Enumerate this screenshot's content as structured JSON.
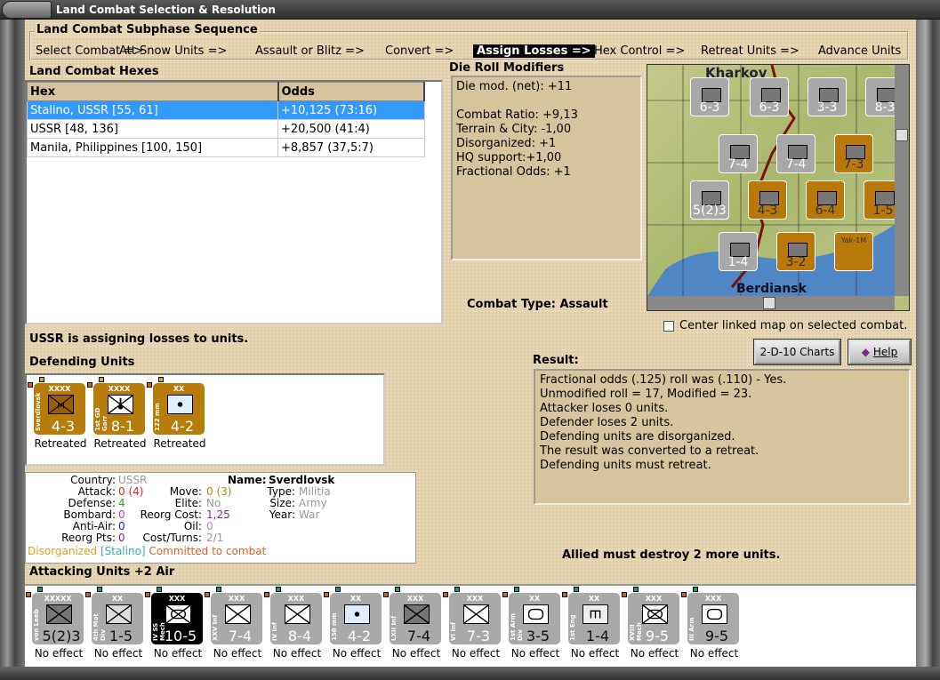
{
  "window": {
    "title": "Land Combat Selection & Resolution"
  },
  "sequence": {
    "title": "Land Combat Subphase Sequence",
    "items": [
      "Select Combat =>",
      "Att Snow Units =>",
      "Assault or Blitz =>",
      "Convert =>",
      "Assign Losses =>",
      "Hex Control =>",
      "Retreat Units =>",
      "Advance Units"
    ],
    "active_index": 4
  },
  "hexes": {
    "title": "Land Combat Hexes",
    "columns": [
      "Hex",
      "Odds"
    ],
    "rows": [
      [
        "Stalino, USSR [55, 61]",
        "+10,125 (73:16)"
      ],
      [
        "USSR [48, 136]",
        "+20,500 (41:4)"
      ],
      [
        "Manila, Philippines [100, 150]",
        "+8,857 (37,5:7)"
      ]
    ],
    "selected_index": 0
  },
  "die": {
    "title": "Die Roll Modifiers",
    "lines": [
      "Die mod. (net): +11",
      "",
      "Combat Ratio: +9,13",
      "Terrain & City: -1,00",
      "Disorganized: +1",
      "HQ support:+1,00",
      "Fractional Odds: +1"
    ]
  },
  "map": {
    "labels": [
      "Kharkov",
      "Berdiansk"
    ],
    "counters": [
      {
        "v": "6-3",
        "c": "g"
      },
      {
        "v": "6-3",
        "c": "g"
      },
      {
        "v": "3-3",
        "c": "g"
      },
      {
        "v": "8-3",
        "c": "g"
      },
      {
        "v": "7-4",
        "c": "g"
      },
      {
        "v": "7-4",
        "c": "g"
      },
      {
        "v": "7-3",
        "c": "o"
      },
      {
        "v": "5(2)3",
        "c": "g"
      },
      {
        "v": "4-3",
        "c": "o"
      },
      {
        "v": "6-4",
        "c": "o"
      },
      {
        "v": "1-5",
        "c": "o"
      },
      {
        "v": "1-4",
        "c": "g"
      },
      {
        "v": "3-2",
        "c": "o"
      },
      {
        "v": "Yak-1M",
        "c": "o"
      }
    ]
  },
  "combat_type": "Combat Type:  Assault",
  "center_map": {
    "label": "Center linked map on selected combat.",
    "checked": false
  },
  "assign_message": "USSR is assigning losses to units.",
  "buttons": {
    "charts": "2-D-10 Charts",
    "help": "Help"
  },
  "result": {
    "title": "Result:",
    "lines": [
      "Fractional odds (.125) roll was (.110)  - Yes.",
      "Unmodified roll = 17, Modified = 23.",
      "Attacker loses 0 units.",
      "Defender loses 2 units.",
      "Defending units are disorganized.",
      "The result was converted to a retreat.",
      "Defending units must retreat."
    ]
  },
  "defending": {
    "title": "Defending Units",
    "units": [
      {
        "name": "Sverdlovsk",
        "size": "XXXX",
        "value": "4-3",
        "status": "Retreated",
        "sym": "mil",
        "style": "or"
      },
      {
        "name": "1st GD Garr",
        "size": "XXXX",
        "value": "8-1",
        "status": "Retreated",
        "sym": "garr",
        "style": "or"
      },
      {
        "name": "122 mm",
        "size": "XX",
        "value": "4-2",
        "status": "Retreated",
        "sym": "art",
        "style": "or"
      }
    ]
  },
  "info": {
    "country_label": "Country:",
    "country": "USSR",
    "attack_label": "Attack:",
    "attack": "0 (4)",
    "defense_label": "Defense:",
    "defense": "4",
    "bombard_label": "Bombard:",
    "bombard": "0",
    "aa_label": "Anti-Air:",
    "aa": "0",
    "reorg_pts_label": "Reorg Pts:",
    "reorg_pts": "0",
    "name_label": "Name:",
    "name": "Sverdlovsk",
    "move_label": "Move:",
    "move": "0 (3)",
    "elite_label": "Elite:",
    "elite": "No",
    "reorg_cost_label": "Reorg Cost:",
    "reorg_cost": "1,25",
    "oil_label": "Oil:",
    "oil": "0",
    "cost_label": "Cost/Turns:",
    "cost": "2/1",
    "type_label": "Type:",
    "type": "Militia",
    "size_label": "Size:",
    "size": "Army",
    "year_label": "Year:",
    "year": "War",
    "status1": "Disorganized",
    "status2": "[Stalino]",
    "status3": "Committed to combat"
  },
  "allied_message": "Allied must destroy 2 more units.",
  "attacking": {
    "title": "Attacking Units +2 Air",
    "units": [
      {
        "name": "von Leeb",
        "size": "XXXXX",
        "value": "5(2)3",
        "status": "No effect",
        "sym": "infd",
        "style": "gy"
      },
      {
        "name": "4th Mot Div",
        "size": "XX",
        "value": "1-5",
        "status": "No effect",
        "sym": "mot",
        "style": "gy"
      },
      {
        "name": "IV SS Mech",
        "size": "XXX",
        "value": "10-5",
        "status": "No effect",
        "sym": "mech",
        "style": "blk"
      },
      {
        "name": "XXV Inf",
        "size": "XXX",
        "value": "7-4",
        "status": "No effect",
        "sym": "inf",
        "style": "gy"
      },
      {
        "name": "IV Inf",
        "size": "XXX",
        "value": "8-4",
        "status": "No effect",
        "sym": "inf",
        "style": "gy"
      },
      {
        "name": "150 mm",
        "size": "XX",
        "value": "4-2",
        "status": "No effect",
        "sym": "art",
        "style": "gy"
      },
      {
        "name": "LXII Inf",
        "size": "XXX",
        "value": "7-4",
        "status": "No effect",
        "sym": "infd",
        "style": "gy"
      },
      {
        "name": "VI Inf",
        "size": "XXX",
        "value": "7-3",
        "status": "No effect",
        "sym": "inf",
        "style": "gy"
      },
      {
        "name": "1st Arm Div",
        "size": "XX",
        "value": "3-5",
        "status": "No effect",
        "sym": "arm",
        "style": "gy"
      },
      {
        "name": "1st Eng",
        "size": "XX",
        "value": "1-4",
        "status": "No effect",
        "sym": "eng",
        "style": "gy"
      },
      {
        "name": "XVIII Mech",
        "size": "XXX",
        "value": "9-5",
        "status": "No effect",
        "sym": "mech",
        "style": "gy"
      },
      {
        "name": "III Arm",
        "size": "XXX",
        "value": "9-5",
        "status": "No effect",
        "sym": "arm",
        "style": "gy"
      }
    ]
  },
  "colors": {
    "accent": "#3399ff",
    "counter_gray": "#a9a9a9",
    "counter_orange": "#b67c0c",
    "panel": "#d6c49c"
  }
}
